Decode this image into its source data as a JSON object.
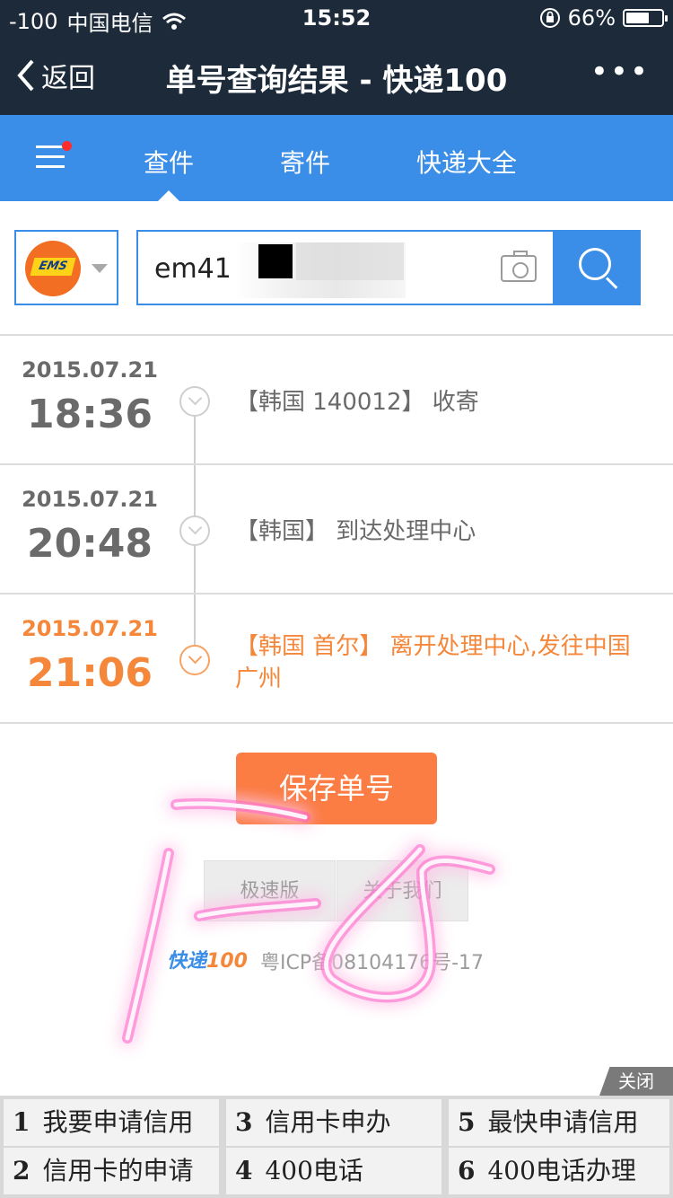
{
  "status_bar": {
    "signal": "-100",
    "carrier": "中国电信",
    "time": "15:52",
    "battery": "66%",
    "battery_level": 0.66
  },
  "nav": {
    "back_label": "返回",
    "title": "单号查询结果 - 快递100",
    "more_label": "•••"
  },
  "tabs": [
    {
      "label": "查件",
      "active": true
    },
    {
      "label": "寄件",
      "active": false
    },
    {
      "label": "快递大全",
      "active": false
    }
  ],
  "search": {
    "company": "EMS",
    "tracking_value": "em41",
    "button_icon": "search-icon"
  },
  "tracking": [
    {
      "date": "2015.07.21",
      "time": "18:36",
      "event": "【韩国 140012】 收寄",
      "latest": false
    },
    {
      "date": "2015.07.21",
      "time": "20:48",
      "event": "【韩国】 到达处理中心",
      "latest": false
    },
    {
      "date": "2015.07.21",
      "time": "21:06",
      "event": "【韩国 首尔】 离开处理中心,发往中国 广州",
      "latest": true
    }
  ],
  "actions": {
    "save_label": "保存单号",
    "fast_version_label": "极速版",
    "about_label": "关于我们"
  },
  "footer": {
    "logo_text": "快递",
    "logo_num": "100",
    "icp": "粤ICP备08104176号-17"
  },
  "ad": {
    "close_label": "关闭",
    "items": [
      {
        "num": "1",
        "text": "我要申请信用"
      },
      {
        "num": "3",
        "text": "信用卡申办"
      },
      {
        "num": "5",
        "text": "最快申请信用"
      },
      {
        "num": "2",
        "text": "信用卡的申请"
      },
      {
        "num": "4",
        "text": "400电话"
      },
      {
        "num": "6",
        "text": "400电话办理"
      }
    ]
  },
  "colors": {
    "nav_bg": "#1c2a3a",
    "brand_blue": "#3b8ee7",
    "accent_orange": "#fb7d43",
    "latest_orange": "#f5873a"
  }
}
